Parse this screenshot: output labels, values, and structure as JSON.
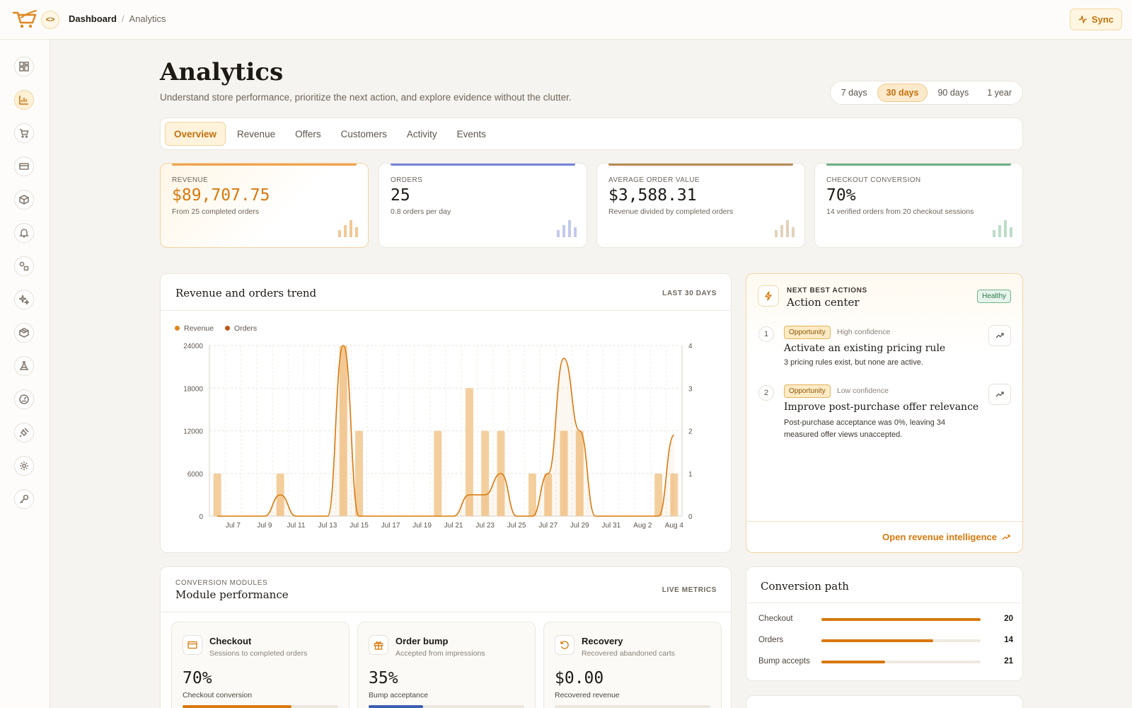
{
  "breadcrumb": {
    "home": "Dashboard",
    "separator": "/",
    "current": "Analytics"
  },
  "topbar": {
    "sync_label": "Sync",
    "collapse_glyph": "<>"
  },
  "sidebar": {
    "icons": [
      "dashboard-icon",
      "analytics-icon",
      "cart-icon",
      "card-icon",
      "box-icon",
      "bell-icon",
      "shapes-icon",
      "sparkle-icon",
      "package-icon",
      "flask-icon",
      "gauge-icon",
      "plug-icon",
      "gear-icon",
      "key-icon"
    ],
    "active": "analytics-icon"
  },
  "header": {
    "title": "Analytics",
    "subtitle": "Understand store performance, prioritize the next action, and explore evidence without the clutter."
  },
  "range": {
    "options": [
      "7 days",
      "30 days",
      "90 days",
      "1 year"
    ],
    "selected": "30 days"
  },
  "tabs": {
    "items": [
      "Overview",
      "Revenue",
      "Offers",
      "Customers",
      "Activity",
      "Events"
    ],
    "active": "Overview"
  },
  "kpis": [
    {
      "label": "REVENUE",
      "value": "$89,707.75",
      "sub": "From 25 completed orders",
      "color": "#e58a1f"
    },
    {
      "label": "ORDERS",
      "value": "25",
      "sub": "0.8 orders per day",
      "color": "#6f7fd6"
    },
    {
      "label": "AVERAGE ORDER VALUE",
      "value": "$3,588.31",
      "sub": "Revenue divided by completed orders",
      "color": "#b58a55"
    },
    {
      "label": "CHECKOUT CONVERSION",
      "value": "70%",
      "sub": "14 verified orders from 20 checkout sessions",
      "color": "#6fae87"
    }
  ],
  "trend": {
    "title": "Revenue and orders trend",
    "tag": "LAST 30 DAYS"
  },
  "chart_data": {
    "type": "bar",
    "title": "Revenue and orders trend",
    "legend": [
      "Revenue",
      "Orders"
    ],
    "x": [
      "Jul 6",
      "Jul 7",
      "Jul 8",
      "Jul 9",
      "Jul 10",
      "Jul 11",
      "Jul 12",
      "Jul 13",
      "Jul 14",
      "Jul 15",
      "Jul 16",
      "Jul 17",
      "Jul 18",
      "Jul 19",
      "Jul 20",
      "Jul 21",
      "Jul 22",
      "Jul 23",
      "Jul 24",
      "Jul 25",
      "Jul 26",
      "Jul 27",
      "Jul 28",
      "Jul 29",
      "Jul 30",
      "Jul 31",
      "Aug 1",
      "Aug 2",
      "Aug 3",
      "Aug 4"
    ],
    "x_tick_labels": [
      "Jul 7",
      "Jul 9",
      "Jul 11",
      "Jul 13",
      "Jul 15",
      "Jul 17",
      "Jul 19",
      "Jul 21",
      "Jul 23",
      "Jul 25",
      "Jul 27",
      "Jul 29",
      "Jul 31",
      "Aug 2",
      "Aug 4"
    ],
    "series": [
      {
        "name": "Revenue",
        "axis": "left",
        "render": "bar",
        "color": "#f4cf9e",
        "values": [
          6000,
          0,
          0,
          0,
          6000,
          0,
          0,
          0,
          24000,
          12000,
          0,
          0,
          0,
          0,
          12000,
          0,
          18000,
          12000,
          12000,
          0,
          6000,
          6000,
          12000,
          12000,
          0,
          0,
          0,
          0,
          6000,
          6000
        ]
      },
      {
        "name": "Orders",
        "axis": "right",
        "render": "line",
        "color": "#d9780b",
        "values": [
          0,
          0,
          0,
          0,
          0.5,
          0,
          0,
          0,
          4,
          0,
          0,
          0,
          0,
          0,
          0,
          0,
          0.5,
          0.5,
          1,
          0,
          0,
          1,
          3.7,
          2,
          0,
          0,
          0,
          0,
          0,
          1.9
        ]
      }
    ],
    "y_left": {
      "min": 0,
      "max": 24000,
      "ticks": [
        0,
        6000,
        12000,
        18000,
        24000
      ]
    },
    "y_right": {
      "min": 0,
      "max": 4,
      "ticks": [
        0,
        1,
        2,
        3,
        4
      ]
    },
    "grid": true,
    "legend_position": "top-left"
  },
  "actions": {
    "eyebrow": "NEXT BEST ACTIONS",
    "title": "Action center",
    "status": "Healthy",
    "items": [
      {
        "num": "1",
        "badge": "Opportunity",
        "confidence": "High confidence",
        "title": "Activate an existing pricing rule",
        "desc": "3 pricing rules exist, but none are active."
      },
      {
        "num": "2",
        "badge": "Opportunity",
        "confidence": "Low confidence",
        "title": "Improve post-purchase offer relevance",
        "desc": "Post-purchase acceptance was 0%, leaving 34 measured offer views unaccepted."
      }
    ],
    "link": "Open revenue intelligence"
  },
  "modules": {
    "eyebrow": "CONVERSION MODULES",
    "title": "Module performance",
    "tag": "LIVE METRICS",
    "items": [
      {
        "title": "Checkout",
        "sub": "Sessions to completed orders",
        "value": "70%",
        "label": "Checkout conversion",
        "progress": 0.7,
        "color": "#d9780b",
        "icon": "card-icon"
      },
      {
        "title": "Order bump",
        "sub": "Accepted from impressions",
        "value": "35%",
        "label": "Bump acceptance",
        "progress": 0.35,
        "color": "#3c5fb0",
        "icon": "gift-icon"
      },
      {
        "title": "Recovery",
        "sub": "Recovered abandoned carts",
        "value": "$0.00",
        "label": "Recovered revenue",
        "progress": 0,
        "color": "#d9780b",
        "icon": "refresh-icon"
      }
    ]
  },
  "conversion_path": {
    "title": "Conversion path",
    "rows": [
      {
        "label": "Checkout",
        "value": "20",
        "progress": 1.0
      },
      {
        "label": "Orders",
        "value": "14",
        "progress": 0.7
      },
      {
        "label": "Bump accepts",
        "value": "21",
        "progress": 0.4
      }
    ]
  }
}
